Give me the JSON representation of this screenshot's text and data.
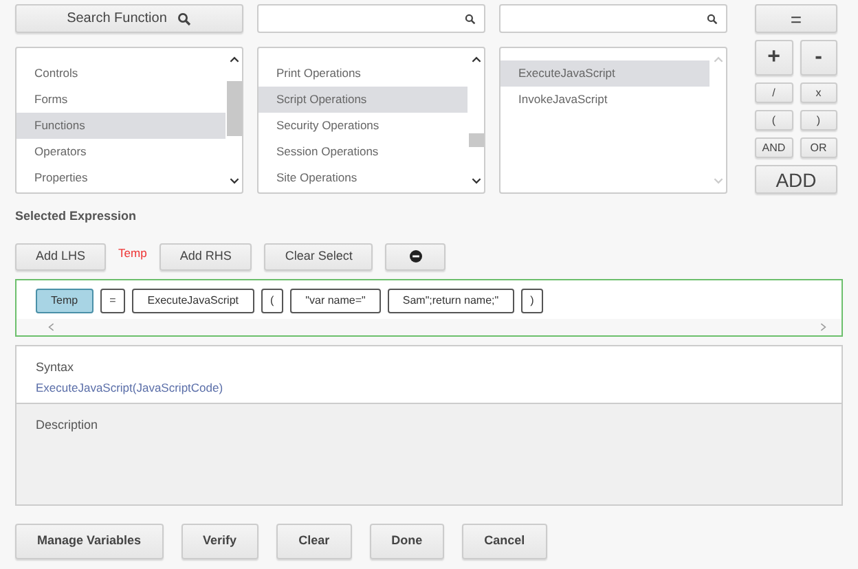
{
  "search_button": {
    "label": "Search Function"
  },
  "lists": [
    {
      "kind": "scroll",
      "search_field": false,
      "items": [
        {
          "label": "Controls",
          "selected": false
        },
        {
          "label": "Forms",
          "selected": false
        },
        {
          "label": "Functions",
          "selected": true
        },
        {
          "label": "Operators",
          "selected": false
        },
        {
          "label": "Properties",
          "selected": false
        }
      ]
    },
    {
      "kind": "scroll",
      "search_field": true,
      "items": [
        {
          "label": "Print Operations",
          "selected": false
        },
        {
          "label": "Script Operations",
          "selected": true
        },
        {
          "label": "Security Operations",
          "selected": false
        },
        {
          "label": "Session Operations",
          "selected": false
        },
        {
          "label": "Site Operations",
          "selected": false
        }
      ]
    },
    {
      "kind": "faded",
      "search_field": true,
      "items": [
        {
          "label": "ExecuteJavaScript",
          "selected": true
        },
        {
          "label": "InvokeJavaScript",
          "selected": false
        }
      ]
    }
  ],
  "operators": [
    {
      "label": "=",
      "kind": "wide"
    },
    {
      "label": "+",
      "kind": "big"
    },
    {
      "label": "-",
      "kind": "big"
    },
    {
      "label": "/",
      "kind": "small"
    },
    {
      "label": "x",
      "kind": "small"
    },
    {
      "label": "(",
      "kind": "small"
    },
    {
      "label": ")",
      "kind": "small"
    },
    {
      "label": "AND",
      "kind": "small"
    },
    {
      "label": "OR",
      "kind": "small"
    },
    {
      "label": "ADD",
      "kind": "wide"
    }
  ],
  "selected_expression": {
    "title": "Selected Expression",
    "buttons": [
      "Add LHS",
      "Add RHS",
      "Clear Select"
    ],
    "lhs_label": "Temp",
    "tokens": [
      {
        "text": "Temp",
        "selected": true
      },
      {
        "text": "=",
        "selected": false
      },
      {
        "text": "ExecuteJavaScript",
        "selected": false
      },
      {
        "text": "(",
        "selected": false
      },
      {
        "text": "\"var name=\"",
        "selected": false
      },
      {
        "text": "Sam\";return name;\"",
        "selected": false
      },
      {
        "text": ")",
        "selected": false
      }
    ]
  },
  "syntax": {
    "title": "Syntax",
    "value": "ExecuteJavaScript(JavaScriptCode)"
  },
  "description": {
    "title": "Description"
  },
  "footer_buttons": [
    "Manage Variables",
    "Verify",
    "Clear",
    "Done",
    "Cancel"
  ]
}
